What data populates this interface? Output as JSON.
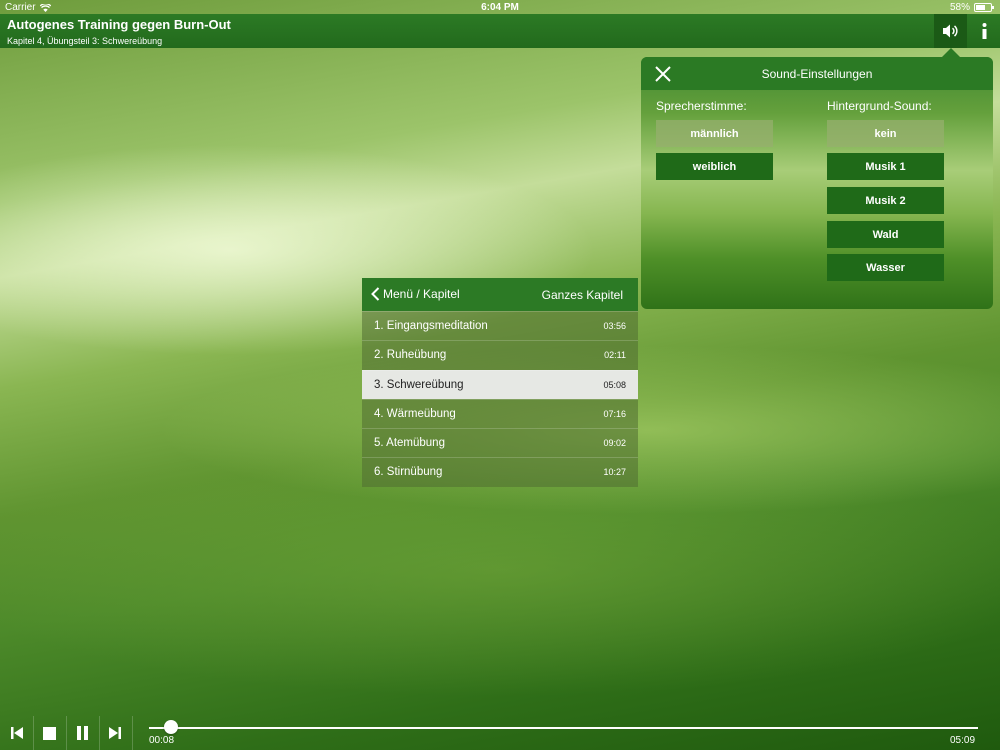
{
  "status_bar": {
    "carrier": "Carrier",
    "time": "6:04 PM",
    "battery": "58%",
    "battery_level": 0.58
  },
  "header": {
    "title": "Autogenes Training gegen Burn-Out",
    "subtitle": "Kapitel 4, Übungsteil 3: Schwereübung",
    "sound_icon": "speaker-icon",
    "info_icon": "info-icon"
  },
  "sound_settings": {
    "title": "Sound-Einstellungen",
    "close_icon": "close-icon",
    "voice_label": "Sprecherstimme:",
    "voice_options": [
      "männlich",
      "weiblich"
    ],
    "voice_selected": "männlich",
    "background_label": "Hintergrund-Sound:",
    "background_options": [
      "kein",
      "Musik 1",
      "Musik 2",
      "Wald",
      "Wasser"
    ],
    "background_selected": "kein"
  },
  "chapter_menu": {
    "back_label": "Menü / Kapitel",
    "whole_chapter_label": "Ganzes Kapitel",
    "items": [
      {
        "label": "1. Eingangsmeditation",
        "duration": "03:56"
      },
      {
        "label": "2. Ruheübung",
        "duration": "02:11"
      },
      {
        "label": "3. Schwereübung",
        "duration": "05:08"
      },
      {
        "label": "4. Wärmeübung",
        "duration": "07:16"
      },
      {
        "label": "5. Atemübung",
        "duration": "09:02"
      },
      {
        "label": "6. Stirnübung",
        "duration": "10:27"
      }
    ],
    "active_index": 2
  },
  "player": {
    "current_time": "00:08",
    "total_time": "05:09",
    "progress": 0.026,
    "accent_color": "#2c7a25"
  }
}
